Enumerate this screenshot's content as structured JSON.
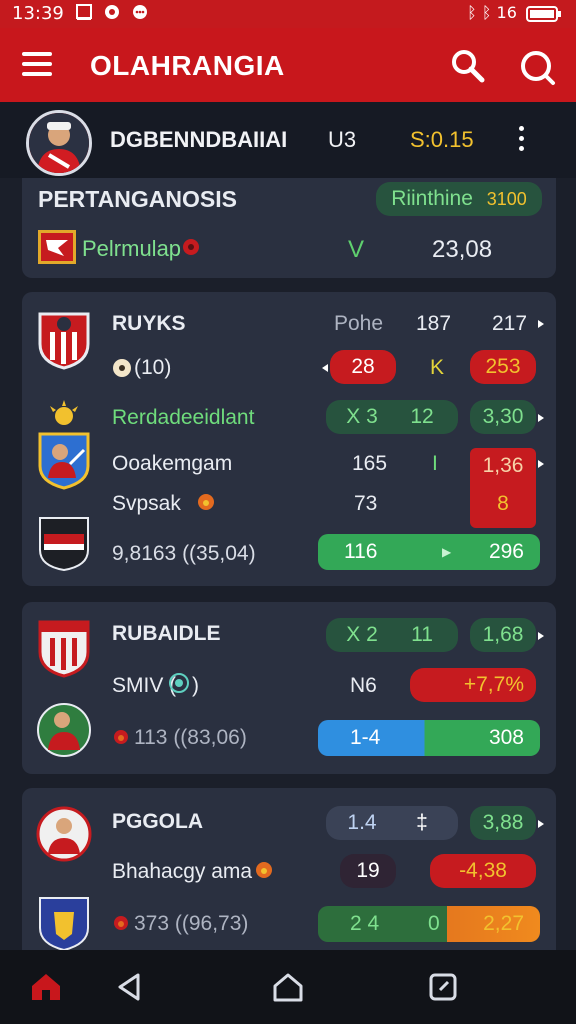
{
  "status": {
    "time": "13:39",
    "right": "ᛒ ᛒ 16"
  },
  "app": {
    "title": "OLAHRANGIA"
  },
  "profile": {
    "name": "DGBENNDBAIIAI",
    "num": "U3",
    "score": "S:0.15"
  },
  "summary": {
    "title": "PERTANGANOSIS",
    "badge_label": "Riinthine",
    "badge_value": "3100",
    "label": "Pelrmulap",
    "mark": "V",
    "value": "23,08"
  },
  "match1": {
    "team1": "RUYKS",
    "col1": "Pohe",
    "col2": "187",
    "col3": "217",
    "rec": "(10)",
    "red1": "28",
    "mid": "K",
    "red2": "253",
    "league": "Rerdadeeidlant",
    "g1": "X 3",
    "g2": "12",
    "g3": "3,30",
    "team2": "Ooakemgam",
    "t2v": "165",
    "t2m": "I",
    "t2r": "1,36",
    "team3": "Svpsak",
    "t3v": "73",
    "t3r": "8",
    "stats": "9,8163 ((35,04)",
    "bar_left": "116",
    "bar_right": "296"
  },
  "match2": {
    "team1": "RUBAIDLE",
    "g1": "X 2",
    "g2": "11",
    "g3": "1,68",
    "rec": "SMIV (",
    "n": "N6",
    "pct": "+7,7%",
    "stats": "113 ((83,06)",
    "bar_left": "1-4",
    "bar_right": "308"
  },
  "match3": {
    "team1": "PGGOLA",
    "g1": "1.4",
    "g2": "‡",
    "g3": "3,88",
    "team2": "Bhahacgy ama",
    "n": "19",
    "neg": "-4,38",
    "stats": "373 ((96,73)",
    "bar_left": "2 4",
    "bar_mid": "0",
    "bar_right": "2,27"
  }
}
